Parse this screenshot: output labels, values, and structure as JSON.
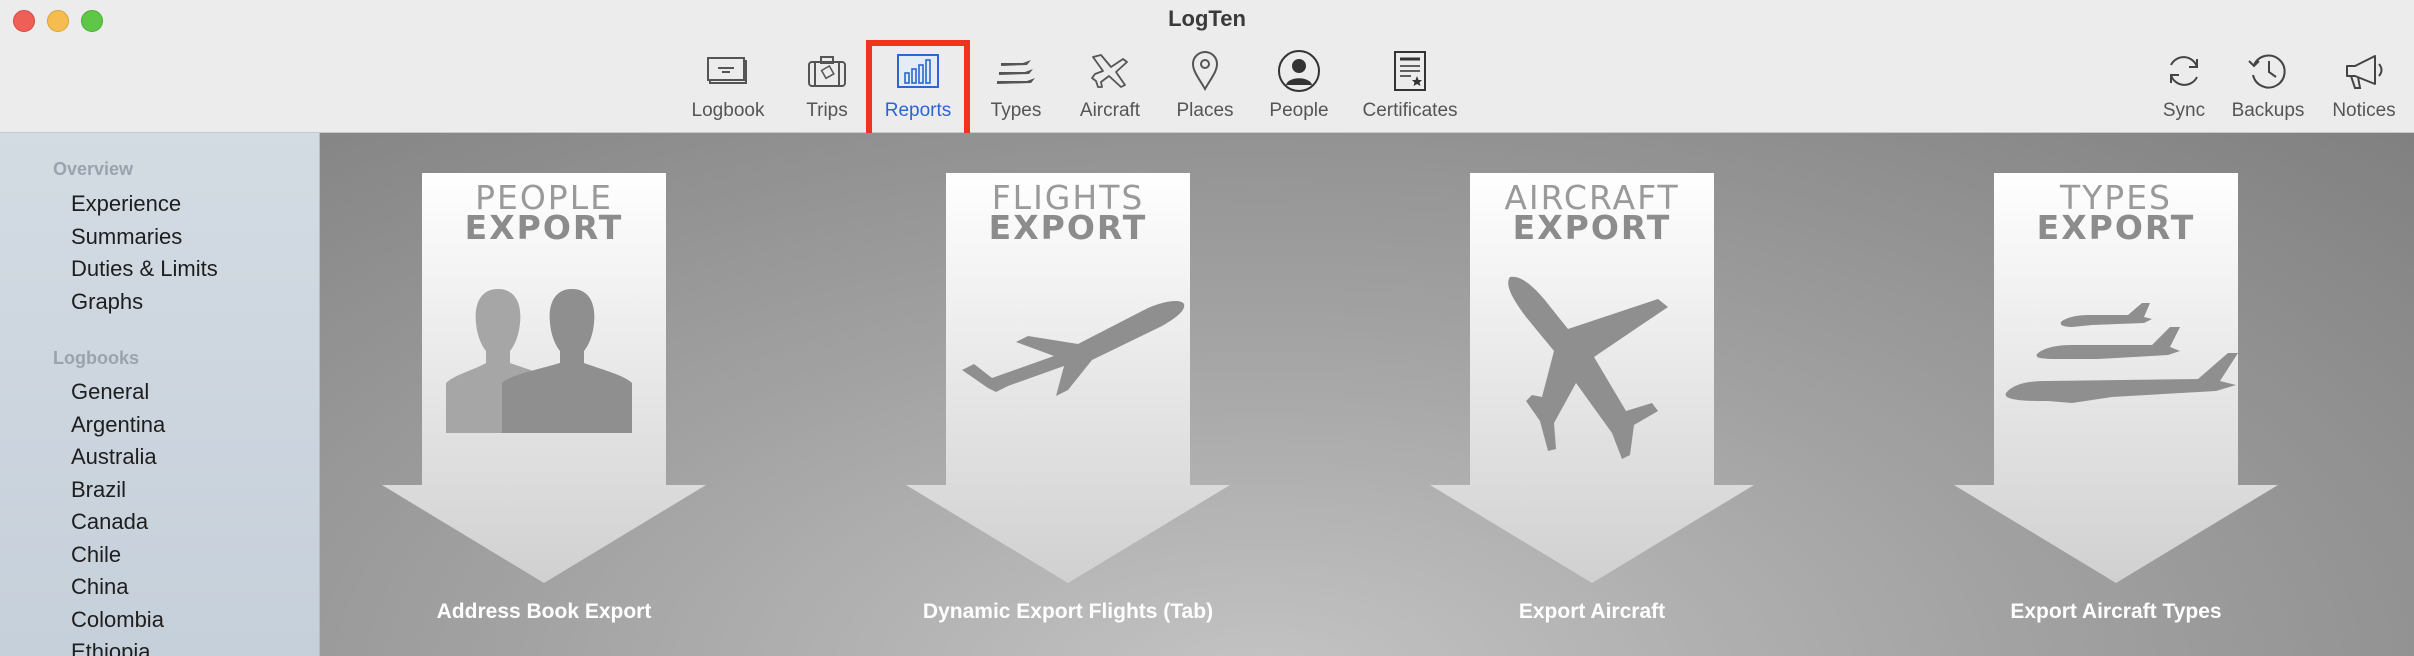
{
  "window": {
    "title": "LogTen"
  },
  "toolbar": {
    "center": [
      {
        "label": "Logbook",
        "icon": "logbook-icon"
      },
      {
        "label": "Trips",
        "icon": "suitcase-icon"
      },
      {
        "label": "Reports",
        "icon": "bar-chart-icon",
        "active": true
      },
      {
        "label": "Types",
        "icon": "aircraft-types-icon"
      },
      {
        "label": "Aircraft",
        "icon": "airplane-icon"
      },
      {
        "label": "Places",
        "icon": "map-pin-icon"
      },
      {
        "label": "People",
        "icon": "person-icon"
      },
      {
        "label": "Certificates",
        "icon": "certificate-icon"
      }
    ],
    "right": [
      {
        "label": "Sync",
        "icon": "sync-icon"
      },
      {
        "label": "Backups",
        "icon": "clock-history-icon"
      },
      {
        "label": "Notices",
        "icon": "megaphone-icon"
      }
    ]
  },
  "sidebar": {
    "sections": [
      {
        "title": "Overview",
        "items": [
          "Experience",
          "Summaries",
          "Duties & Limits",
          "Graphs"
        ]
      },
      {
        "title": "Logbooks",
        "items": [
          "General",
          "Argentina",
          "Australia",
          "Brazil",
          "Canada",
          "Chile",
          "China",
          "Colombia",
          "Ethiopia"
        ]
      }
    ]
  },
  "reports": [
    {
      "line1": "PEOPLE",
      "line2": "EXPORT",
      "caption": "Address Book Export",
      "icon": "people-silhouette-icon"
    },
    {
      "line1": "FLIGHTS",
      "line2": "EXPORT",
      "caption": "Dynamic Export Flights (Tab)",
      "icon": "airplane-takeoff-icon"
    },
    {
      "line1": "AIRCRAFT",
      "line2": "EXPORT",
      "caption": "Export Aircraft",
      "icon": "airplane-topview-icon"
    },
    {
      "line1": "TYPES",
      "line2": "EXPORT",
      "caption": "Export Aircraft Types",
      "icon": "airplane-fleet-icon"
    }
  ],
  "colors": {
    "accent": "#2a66d4",
    "highlight": "#f0331f"
  }
}
